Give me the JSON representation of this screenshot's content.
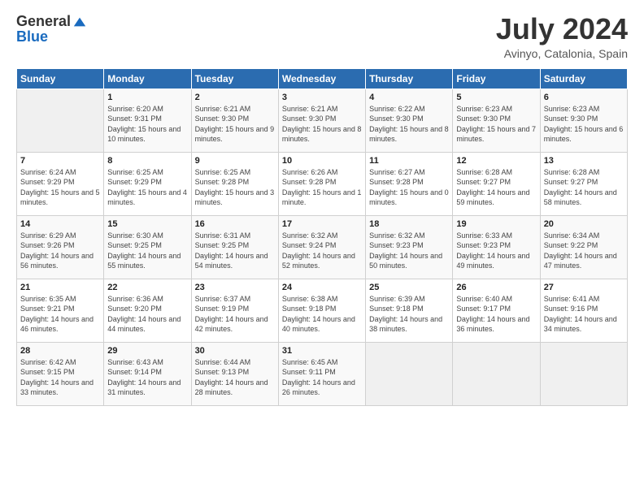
{
  "header": {
    "logo_general": "General",
    "logo_blue": "Blue",
    "month_title": "July 2024",
    "location": "Avinyo, Catalonia, Spain"
  },
  "weekdays": [
    "Sunday",
    "Monday",
    "Tuesday",
    "Wednesday",
    "Thursday",
    "Friday",
    "Saturday"
  ],
  "weeks": [
    [
      {
        "day": "",
        "sunrise": "",
        "sunset": "",
        "daylight": ""
      },
      {
        "day": "1",
        "sunrise": "Sunrise: 6:20 AM",
        "sunset": "Sunset: 9:31 PM",
        "daylight": "Daylight: 15 hours and 10 minutes."
      },
      {
        "day": "2",
        "sunrise": "Sunrise: 6:21 AM",
        "sunset": "Sunset: 9:30 PM",
        "daylight": "Daylight: 15 hours and 9 minutes."
      },
      {
        "day": "3",
        "sunrise": "Sunrise: 6:21 AM",
        "sunset": "Sunset: 9:30 PM",
        "daylight": "Daylight: 15 hours and 8 minutes."
      },
      {
        "day": "4",
        "sunrise": "Sunrise: 6:22 AM",
        "sunset": "Sunset: 9:30 PM",
        "daylight": "Daylight: 15 hours and 8 minutes."
      },
      {
        "day": "5",
        "sunrise": "Sunrise: 6:23 AM",
        "sunset": "Sunset: 9:30 PM",
        "daylight": "Daylight: 15 hours and 7 minutes."
      },
      {
        "day": "6",
        "sunrise": "Sunrise: 6:23 AM",
        "sunset": "Sunset: 9:30 PM",
        "daylight": "Daylight: 15 hours and 6 minutes."
      }
    ],
    [
      {
        "day": "7",
        "sunrise": "Sunrise: 6:24 AM",
        "sunset": "Sunset: 9:29 PM",
        "daylight": "Daylight: 15 hours and 5 minutes."
      },
      {
        "day": "8",
        "sunrise": "Sunrise: 6:25 AM",
        "sunset": "Sunset: 9:29 PM",
        "daylight": "Daylight: 15 hours and 4 minutes."
      },
      {
        "day": "9",
        "sunrise": "Sunrise: 6:25 AM",
        "sunset": "Sunset: 9:28 PM",
        "daylight": "Daylight: 15 hours and 3 minutes."
      },
      {
        "day": "10",
        "sunrise": "Sunrise: 6:26 AM",
        "sunset": "Sunset: 9:28 PM",
        "daylight": "Daylight: 15 hours and 1 minute."
      },
      {
        "day": "11",
        "sunrise": "Sunrise: 6:27 AM",
        "sunset": "Sunset: 9:28 PM",
        "daylight": "Daylight: 15 hours and 0 minutes."
      },
      {
        "day": "12",
        "sunrise": "Sunrise: 6:28 AM",
        "sunset": "Sunset: 9:27 PM",
        "daylight": "Daylight: 14 hours and 59 minutes."
      },
      {
        "day": "13",
        "sunrise": "Sunrise: 6:28 AM",
        "sunset": "Sunset: 9:27 PM",
        "daylight": "Daylight: 14 hours and 58 minutes."
      }
    ],
    [
      {
        "day": "14",
        "sunrise": "Sunrise: 6:29 AM",
        "sunset": "Sunset: 9:26 PM",
        "daylight": "Daylight: 14 hours and 56 minutes."
      },
      {
        "day": "15",
        "sunrise": "Sunrise: 6:30 AM",
        "sunset": "Sunset: 9:25 PM",
        "daylight": "Daylight: 14 hours and 55 minutes."
      },
      {
        "day": "16",
        "sunrise": "Sunrise: 6:31 AM",
        "sunset": "Sunset: 9:25 PM",
        "daylight": "Daylight: 14 hours and 54 minutes."
      },
      {
        "day": "17",
        "sunrise": "Sunrise: 6:32 AM",
        "sunset": "Sunset: 9:24 PM",
        "daylight": "Daylight: 14 hours and 52 minutes."
      },
      {
        "day": "18",
        "sunrise": "Sunrise: 6:32 AM",
        "sunset": "Sunset: 9:23 PM",
        "daylight": "Daylight: 14 hours and 50 minutes."
      },
      {
        "day": "19",
        "sunrise": "Sunrise: 6:33 AM",
        "sunset": "Sunset: 9:23 PM",
        "daylight": "Daylight: 14 hours and 49 minutes."
      },
      {
        "day": "20",
        "sunrise": "Sunrise: 6:34 AM",
        "sunset": "Sunset: 9:22 PM",
        "daylight": "Daylight: 14 hours and 47 minutes."
      }
    ],
    [
      {
        "day": "21",
        "sunrise": "Sunrise: 6:35 AM",
        "sunset": "Sunset: 9:21 PM",
        "daylight": "Daylight: 14 hours and 46 minutes."
      },
      {
        "day": "22",
        "sunrise": "Sunrise: 6:36 AM",
        "sunset": "Sunset: 9:20 PM",
        "daylight": "Daylight: 14 hours and 44 minutes."
      },
      {
        "day": "23",
        "sunrise": "Sunrise: 6:37 AM",
        "sunset": "Sunset: 9:19 PM",
        "daylight": "Daylight: 14 hours and 42 minutes."
      },
      {
        "day": "24",
        "sunrise": "Sunrise: 6:38 AM",
        "sunset": "Sunset: 9:18 PM",
        "daylight": "Daylight: 14 hours and 40 minutes."
      },
      {
        "day": "25",
        "sunrise": "Sunrise: 6:39 AM",
        "sunset": "Sunset: 9:18 PM",
        "daylight": "Daylight: 14 hours and 38 minutes."
      },
      {
        "day": "26",
        "sunrise": "Sunrise: 6:40 AM",
        "sunset": "Sunset: 9:17 PM",
        "daylight": "Daylight: 14 hours and 36 minutes."
      },
      {
        "day": "27",
        "sunrise": "Sunrise: 6:41 AM",
        "sunset": "Sunset: 9:16 PM",
        "daylight": "Daylight: 14 hours and 34 minutes."
      }
    ],
    [
      {
        "day": "28",
        "sunrise": "Sunrise: 6:42 AM",
        "sunset": "Sunset: 9:15 PM",
        "daylight": "Daylight: 14 hours and 33 minutes."
      },
      {
        "day": "29",
        "sunrise": "Sunrise: 6:43 AM",
        "sunset": "Sunset: 9:14 PM",
        "daylight": "Daylight: 14 hours and 31 minutes."
      },
      {
        "day": "30",
        "sunrise": "Sunrise: 6:44 AM",
        "sunset": "Sunset: 9:13 PM",
        "daylight": "Daylight: 14 hours and 28 minutes."
      },
      {
        "day": "31",
        "sunrise": "Sunrise: 6:45 AM",
        "sunset": "Sunset: 9:11 PM",
        "daylight": "Daylight: 14 hours and 26 minutes."
      },
      {
        "day": "",
        "sunrise": "",
        "sunset": "",
        "daylight": ""
      },
      {
        "day": "",
        "sunrise": "",
        "sunset": "",
        "daylight": ""
      },
      {
        "day": "",
        "sunrise": "",
        "sunset": "",
        "daylight": ""
      }
    ]
  ]
}
